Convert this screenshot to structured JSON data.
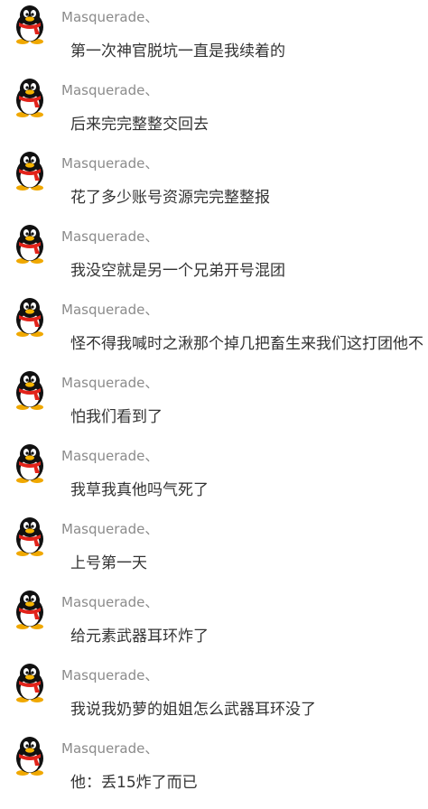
{
  "messages": [
    {
      "sender": "Masquerade、",
      "text": "第一次神官脱坑一直是我续着的"
    },
    {
      "sender": "Masquerade、",
      "text": "后来完完整整交回去"
    },
    {
      "sender": "Masquerade、",
      "text": "花了多少账号资源完完整整报"
    },
    {
      "sender": "Masquerade、",
      "text": "我没空就是另一个兄弟开号混团"
    },
    {
      "sender": "Masquerade、",
      "text": "怪不得我喊时之湫那个掉几把畜生来我们这打团他不"
    },
    {
      "sender": "Masquerade、",
      "text": "怕我们看到了"
    },
    {
      "sender": "Masquerade、",
      "text": "我草我真他吗气死了"
    },
    {
      "sender": "Masquerade、",
      "text": "上号第一天"
    },
    {
      "sender": "Masquerade、",
      "text": "给元素武器耳环炸了"
    },
    {
      "sender": "Masquerade、",
      "text": "我说我奶萝的姐姐怎么武器耳环没了"
    },
    {
      "sender": "Masquerade、",
      "text": "他：丢15炸了而已"
    }
  ],
  "avatar_icon": "qq-penguin-icon"
}
